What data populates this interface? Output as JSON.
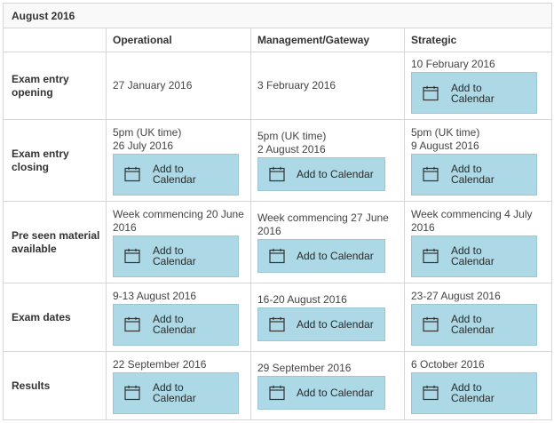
{
  "caption": "August 2016",
  "columns": [
    "",
    "Operational",
    "Management/Gateway",
    "Strategic"
  ],
  "button_label": "Add to Calendar",
  "icon": "calendar-icon",
  "colors": {
    "button_bg": "#add8e6",
    "border": "#d6d6d6"
  },
  "rows": [
    {
      "label": "Exam entry opening",
      "cells": [
        {
          "text": "27 January 2016",
          "button": false
        },
        {
          "text": "3 February 2016",
          "button": false
        },
        {
          "text": "10 February 2016",
          "button": true
        }
      ]
    },
    {
      "label": "Exam entry closing",
      "cells": [
        {
          "text": "5pm (UK time)\n26 July 2016",
          "button": true
        },
        {
          "text": "5pm (UK time)\n2 August 2016",
          "button": true
        },
        {
          "text": "5pm (UK time)\n9 August 2016",
          "button": true
        }
      ]
    },
    {
      "label": "Pre seen material available",
      "cells": [
        {
          "text": "Week commencing 20 June 2016",
          "button": true
        },
        {
          "text": "Week commencing 27 June 2016",
          "button": true
        },
        {
          "text": "Week commencing 4 July 2016",
          "button": true
        }
      ]
    },
    {
      "label": "Exam dates",
      "cells": [
        {
          "text": "9-13 August 2016",
          "button": true
        },
        {
          "text": "16-20 August 2016",
          "button": true
        },
        {
          "text": "23-27 August 2016",
          "button": true
        }
      ]
    },
    {
      "label": "Results",
      "cells": [
        {
          "text": "22 September 2016",
          "button": true
        },
        {
          "text": "29 September 2016",
          "button": true
        },
        {
          "text": "6 October 2016",
          "button": true
        }
      ]
    }
  ]
}
